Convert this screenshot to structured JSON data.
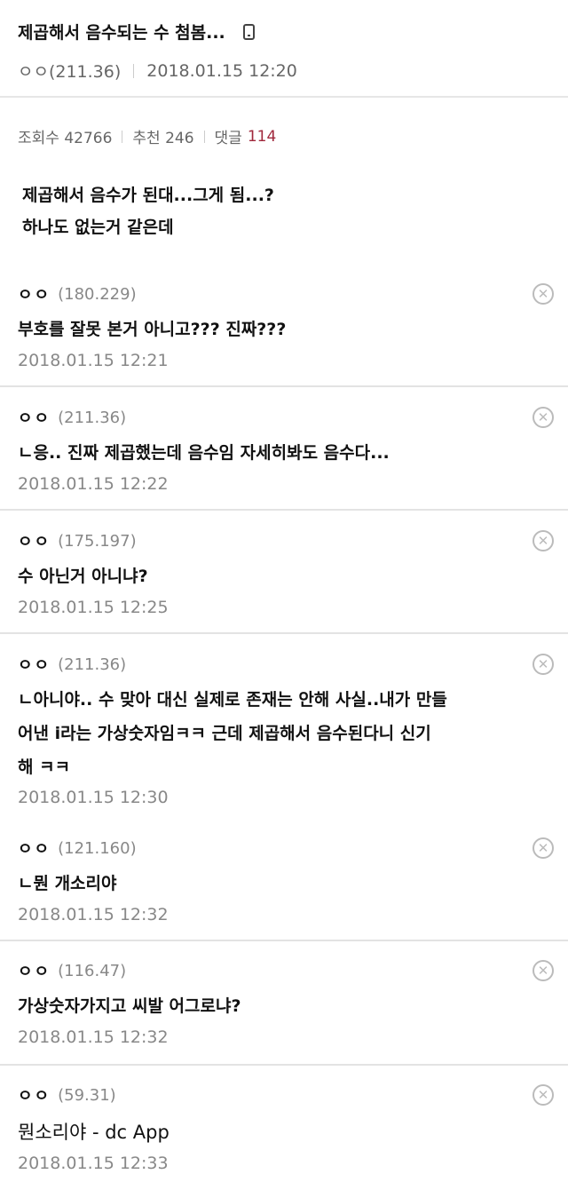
{
  "post": {
    "title": "제곱해서 음수되는 수 첨봄...",
    "author": "ㅇㅇ(211.36)",
    "datetime": "2018.01.15 12:20",
    "views_label": "조회수 42766",
    "recommend_label": "추천 246",
    "comments_label": "댓글",
    "comments_count": "114",
    "body_lines": [
      "제곱해서 음수가 된대...그게 됨...?",
      "하나도 없는거 같은데"
    ]
  },
  "comments": [
    {
      "nick": "ㅇㅇ",
      "ip": "(180.229)",
      "lines": [
        "부호를 잘못 본거 아니고??? 진짜???"
      ],
      "date": "2018.01.15 12:21"
    },
    {
      "nick": "ㅇㅇ",
      "ip": "(211.36)",
      "lines": [
        "ㄴ응.. 진짜 제곱했는데 음수임 자세히봐도 음수다..."
      ],
      "date": "2018.01.15 12:22"
    },
    {
      "nick": "ㅇㅇ",
      "ip": "(175.197)",
      "lines": [
        "수 아닌거 아니냐?"
      ],
      "date": "2018.01.15 12:25"
    },
    {
      "nick": "ㅇㅇ",
      "ip": "(211.36)",
      "lines": [
        "ㄴ아니야.. 수 맞아 대신 실제로 존재는 안해 사실..내가 만들",
        "어낸 i라는 가상숫자임ㅋㅋ 근데 제곱해서 음수된다니 신기",
        "해 ㅋㅋ"
      ],
      "date": "2018.01.15 12:30"
    },
    {
      "nick": "ㅇㅇ",
      "ip": "(121.160)",
      "lines": [
        "ㄴ뭔 개소리야"
      ],
      "date": "2018.01.15 12:32"
    },
    {
      "nick": "ㅇㅇ",
      "ip": "(116.47)",
      "lines": [
        "가상숫자가지고 씨발 어그로냐?"
      ],
      "date": "2018.01.15 12:32"
    },
    {
      "nick": "ㅇㅇ",
      "ip": "(59.31)",
      "lines": [
        "뭔소리야 - dc App"
      ],
      "date": "2018.01.15 12:33"
    }
  ],
  "icons": {
    "device": "mobile-phone-icon",
    "delete": "delete-circle-x-icon"
  }
}
